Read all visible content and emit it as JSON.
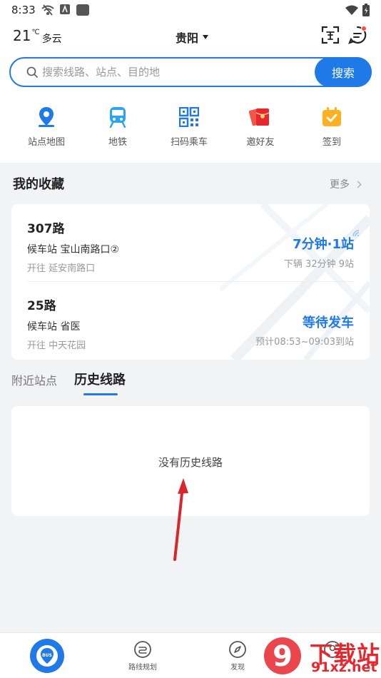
{
  "status_bar": {
    "time": "8:33"
  },
  "header": {
    "temperature": "21",
    "temp_unit": "℃",
    "weather": "多云",
    "city": "贵阳"
  },
  "search": {
    "placeholder": "搜索线路、站点、目的地",
    "button_label": "搜索"
  },
  "quick_actions": [
    {
      "label": "站点地图",
      "icon": "map-pin-icon"
    },
    {
      "label": "地铁",
      "icon": "subway-icon"
    },
    {
      "label": "扫码乘车",
      "icon": "qr-code-icon"
    },
    {
      "label": "邀好友",
      "icon": "red-envelope-icon"
    },
    {
      "label": "签到",
      "icon": "calendar-check-icon"
    }
  ],
  "favorites": {
    "title": "我的收藏",
    "more_label": "更多",
    "routes": [
      {
        "name": "307路",
        "station": "候车站 宝山南路口②",
        "direction": "开往 延安南路口",
        "eta": "7分钟·1站",
        "sub": "下辆 32分钟 9站"
      },
      {
        "name": "25路",
        "station": "候车站 省医",
        "direction": "开往 中天花园",
        "eta": "等待发车",
        "sub": "预计08:53~09:03到站"
      }
    ]
  },
  "tabs": [
    {
      "label": "附近站点",
      "active": false
    },
    {
      "label": "历史线路",
      "active": true
    }
  ],
  "empty_state": "没有历史线路",
  "bottom_nav": [
    {
      "label": "",
      "icon": "bus-icon"
    },
    {
      "label": "路线规划",
      "icon": "route-planning-icon"
    },
    {
      "label": "发现",
      "icon": "compass-icon"
    },
    {
      "label": "",
      "icon": "profile-icon"
    }
  ],
  "watermark": {
    "title": "下载站",
    "url": "91xz.net",
    "logo": "9"
  },
  "colors": {
    "accent": "#1f7ae8",
    "badge": "#ff4b3a",
    "arrow": "#d9262b",
    "watermark": "#e8262e"
  }
}
